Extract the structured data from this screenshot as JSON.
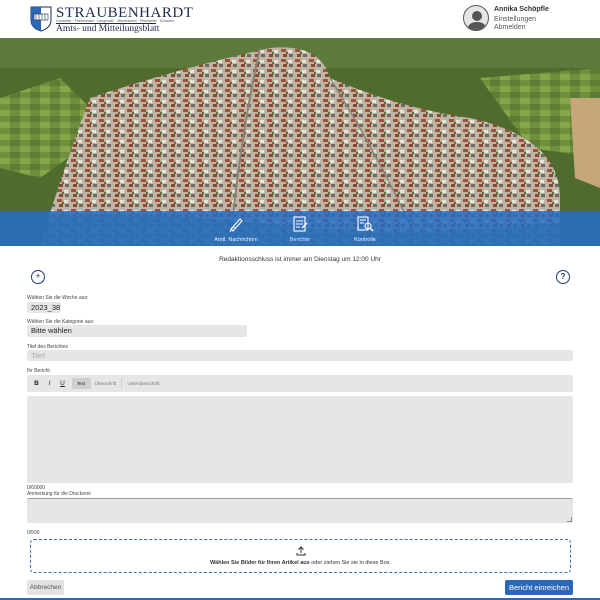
{
  "header": {
    "logo_title": "STRAUBENHARDT",
    "logo_towns": "Conweiler · Feldrennach · Langenalb · Ottenhausen · Pfinzweiler · Schwann",
    "logo_subtitle": "Amts- und Mitteilungsblatt",
    "user_name": "Annika Schöpfle",
    "settings_label": "Einstellungen",
    "logout_label": "Abmelden"
  },
  "nav": {
    "items": [
      {
        "label": "Amtl. Nachrichten",
        "icon": "pen-hand-icon"
      },
      {
        "label": "Berichte",
        "icon": "report-edit-icon"
      },
      {
        "label": "Kontrolle",
        "icon": "document-search-icon"
      }
    ]
  },
  "form": {
    "deadline": "Redaktionsschluss ist immer am Dienstag um 12:00 Uhr",
    "week_label": "Wählen Sie die Woche aus:",
    "week_value": "2023_38",
    "category_label": "Wählen Sie die Kategorie aus:",
    "category_value": "Bitte wählen",
    "title_label": "Titel des Berichtes",
    "title_placeholder": "Titel",
    "report_label": "Ihr Bericht",
    "toolbar": {
      "bold": "B",
      "italic": "I",
      "underline": "U",
      "text": "Text",
      "heading": "Überschrift",
      "subheading": "Unterüberschrift"
    },
    "report_counter": "0/60000",
    "notes_label": "Anmerkung für die Druckerei",
    "notes_counter": "0/500",
    "dropzone_bold": "Wählen Sie Bilder für Ihren Artikel aus",
    "dropzone_rest": " oder ziehen Sie sie in diese Box.",
    "cancel_label": "Abbrechen",
    "submit_label": "Bericht einreichen"
  },
  "colors": {
    "accent": "#2d67b7",
    "nav_bar": "#246cc4",
    "field_bg": "#e6e6e6"
  }
}
